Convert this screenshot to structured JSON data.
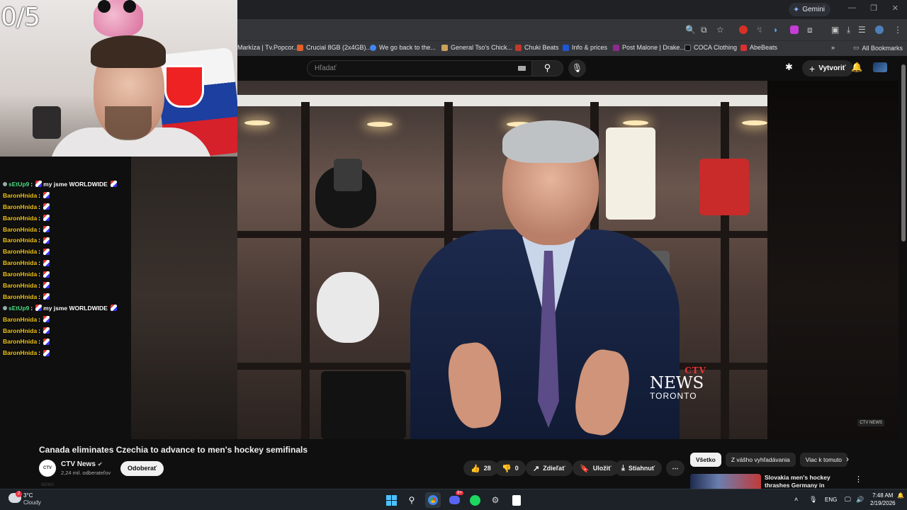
{
  "overlay": {
    "counter": "0/5",
    "chat": [
      {
        "user": "sEtUp9",
        "msg": "my jsme WORLDWIDE",
        "kind": "setup"
      },
      {
        "user": "BaronHnida",
        "msg": "",
        "kind": "baron"
      },
      {
        "user": "BaronHnida",
        "msg": "",
        "kind": "baron"
      },
      {
        "user": "BaronHnida",
        "msg": "",
        "kind": "baron"
      },
      {
        "user": "BaronHnida",
        "msg": "",
        "kind": "baron"
      },
      {
        "user": "BaronHnida",
        "msg": "",
        "kind": "baron"
      },
      {
        "user": "BaronHnida",
        "msg": "",
        "kind": "baron"
      },
      {
        "user": "BaronHnida",
        "msg": "",
        "kind": "baron"
      },
      {
        "user": "BaronHnida",
        "msg": "",
        "kind": "baron"
      },
      {
        "user": "BaronHnida",
        "msg": "",
        "kind": "baron"
      },
      {
        "user": "BaronHnida",
        "msg": "",
        "kind": "baron"
      },
      {
        "user": "sEtUp9",
        "msg": "my jsme WORLDWIDE",
        "kind": "setup"
      },
      {
        "user": "BaronHnida",
        "msg": "",
        "kind": "baron"
      },
      {
        "user": "BaronHnida",
        "msg": "",
        "kind": "baron"
      },
      {
        "user": "BaronHnida",
        "msg": "",
        "kind": "baron"
      },
      {
        "user": "BaronHnida",
        "msg": "",
        "kind": "baron"
      }
    ]
  },
  "browser": {
    "gemini_label": "Gemini",
    "bookmarks": [
      {
        "label": "Markíza | Tv.Popcor...",
        "color": "#4a4a4a"
      },
      {
        "label": "Crucial 8GB (2x4GB)...",
        "color": "#e0612b"
      },
      {
        "label": "We go back to the...",
        "color": "#4285f4"
      },
      {
        "label": "General Tso's Chick...",
        "color": "#c9a15a"
      },
      {
        "label": "Chuki Beats",
        "color": "#c0392b"
      },
      {
        "label": "Info & prices",
        "color": "#1e56d6"
      },
      {
        "label": "Post Malone | Drake...",
        "color": "#8e2b8e"
      },
      {
        "label": "COCA Clothing",
        "color": "#222222"
      },
      {
        "label": "AbeBeats",
        "color": "#d83030"
      }
    ],
    "all_bookmarks": "All Bookmarks"
  },
  "youtube": {
    "search_placeholder": "Hľadať",
    "create_label": "Vytvoriť",
    "video_title": "Canada eliminates Czechia to advance to men's hockey semifinals",
    "channel_name": "CTV News",
    "channel_subs": "2,24 mil. odberateľov",
    "channel_avatar_text": "CTV NEWS",
    "subscribe_label": "Odoberať",
    "likes": "28",
    "dislikes": "0",
    "share_label": "Zdieľať",
    "save_label": "Uložiť",
    "download_label": "Stiahnuť",
    "chips": [
      "Všetko",
      "Z vášho vyhľadávania",
      "Viac k tomuto"
    ],
    "rec_title": "Slovakia men's hockey thrashes Germany in quarterfinal round",
    "player_logo": {
      "top": "CTV",
      "main": "NEWS",
      "city": "TORONTO"
    },
    "corner_logo": "CTV NEWS"
  },
  "taskbar": {
    "weather_temp": "3°C",
    "weather_desc": "Cloudy",
    "weather_badge": "2",
    "discord_badge": "9+",
    "lang": "ENG",
    "time": "7:48 AM",
    "date": "2/19/2026"
  }
}
